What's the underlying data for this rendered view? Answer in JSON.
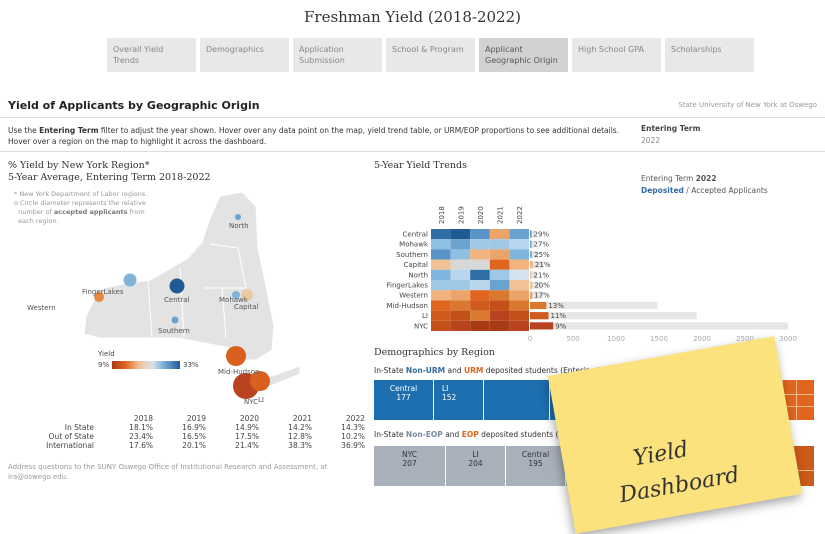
{
  "header": {
    "title": "Freshman Yield (2018-2022)"
  },
  "tabs": [
    {
      "label": "Overall Yield Trends"
    },
    {
      "label": "Demographics"
    },
    {
      "label": "Application Submission"
    },
    {
      "label": "School & Program"
    },
    {
      "label": "Applicant Geographic Origin"
    },
    {
      "label": "High School GPA"
    },
    {
      "label": "Scholarships"
    }
  ],
  "active_tab": "Applicant Geographic Origin",
  "section": {
    "title": "Yield of Applicants by Geographic Origin",
    "org": "State University of New York at Oswego",
    "intro_1": "Use the ",
    "intro_bold": "Entering Term",
    "intro_2": " filter to adjust the year shown. Hover over any data point on the map, yield trend table, or URM/EOP proportions to see additional details.",
    "intro_3": "Hover over a region on the map to highlight it across the dashboard."
  },
  "filter": {
    "label": "Entering Term",
    "value": "2022"
  },
  "map": {
    "title_1": "% Yield by New York Region*",
    "title_2": "5-Year Average, Entering Term 2018-2022",
    "note_1": "* New York Department of Labor regions.",
    "note_2": "o Circle diameter represents the relative",
    "note_3a": "number of ",
    "note_3b": "accepted applicants",
    "note_3c": " from",
    "note_4": "each region.",
    "labels": {
      "north": "North",
      "fingerlakes": "FingerLakes",
      "central": "Central",
      "mohawk": "Mohawk",
      "capital": "Capital",
      "western": "Western",
      "southern": "Southern",
      "midhudson": "Mid-Hudson",
      "nyc": "NYC",
      "li": "LI"
    },
    "legend": {
      "title": "Yield",
      "min": "9%",
      "max": "33%"
    },
    "colors": {
      "orange": "#e0661f",
      "blue": "#2f6ea6",
      "light_blue": "#7fb5dc",
      "beige": "#e8cba3",
      "dark_red": "#b8431e"
    }
  },
  "yield_table": {
    "years": [
      "2018",
      "2019",
      "2020",
      "2021",
      "2022"
    ],
    "rows": [
      {
        "label": "In State",
        "values": [
          "18.1%",
          "16.9%",
          "14.9%",
          "14.2%",
          "14.3%"
        ]
      },
      {
        "label": "Out of State",
        "values": [
          "23.4%",
          "16.5%",
          "17.5%",
          "12.8%",
          "10.2%"
        ]
      },
      {
        "label": "International",
        "values": [
          "17.6%",
          "20.1%",
          "21.4%",
          "38.3%",
          "36.9%"
        ]
      }
    ]
  },
  "footer": {
    "line1": "Address questions to the SUNY Oswego Office of Institutional Research and Assessment, at",
    "line2": "ira@oswego.edu."
  },
  "trends": {
    "title": "5-Year Yield Trends",
    "legend_line1_a": "Entering Term ",
    "legend_line1_b": "2022",
    "legend_line2_a": "Deposited",
    "legend_line2_b": " / Accepted Applicants"
  },
  "chart_data": {
    "type": "bar",
    "categories": [
      "Central",
      "Mohawk",
      "Southern",
      "Capital",
      "North",
      "FingerLakes",
      "Western",
      "Mid-Hudson",
      "LI",
      "NYC"
    ],
    "heatmap_years": [
      "2018",
      "2019",
      "2020",
      "2021",
      "2022"
    ],
    "heatmap_colors": [
      [
        "#2f6ea6",
        "#1f5a94",
        "#5a93c6",
        "#eba56a",
        "#6aa2d0"
      ],
      [
        "#8fbfe2",
        "#6aa2d0",
        "#9fc8e6",
        "#9fc8e6",
        "#b9d6ec"
      ],
      [
        "#5a93c6",
        "#8fbfe2",
        "#f2b37e",
        "#eba56a",
        "#7fb5dc"
      ],
      [
        "#f2c195",
        "#d8d8d8",
        "#d8d8d8",
        "#e0661f",
        "#f2b37e"
      ],
      [
        "#7fb5dc",
        "#b9d6ec",
        "#2f6ea6",
        "#9fc8e6",
        "#d5e3ee"
      ],
      [
        "#9fc8e6",
        "#9fc8e6",
        "#b9d6ec",
        "#6aa2d0",
        "#f2c195"
      ],
      [
        "#f2b37e",
        "#eba56a",
        "#e0661f",
        "#d9792f",
        "#eba56a"
      ],
      [
        "#e0661f",
        "#d9792f",
        "#cf5a1e",
        "#c45019",
        "#d9792f"
      ],
      [
        "#cf5a1e",
        "#c45019",
        "#d9792f",
        "#b8431e",
        "#c45019"
      ],
      [
        "#c45019",
        "#b8431e",
        "#a83a16",
        "#a83a16",
        "#b8431e"
      ]
    ],
    "percent_labels": [
      "29%",
      "27%",
      "25%",
      "21%",
      "21%",
      "20%",
      "17%",
      "13%",
      "11%",
      "9%"
    ],
    "accepted": [
      55,
      50,
      95,
      160,
      80,
      135,
      150,
      1480,
      1940,
      3000
    ],
    "deposited": [
      16,
      13,
      24,
      34,
      17,
      27,
      26,
      190,
      215,
      270
    ],
    "bar_colors": [
      "#5a93c6",
      "#6aa2d0",
      "#7fb5dc",
      "#f2b37e",
      "#f2c195",
      "#f2c195",
      "#eba56a",
      "#d9792f",
      "#cf5a1e",
      "#b8431e"
    ],
    "xticks": [
      "0",
      "500",
      "1000",
      "1500",
      "2000",
      "2500",
      "3000"
    ],
    "xlim": [
      0,
      3000
    ]
  },
  "demographics": {
    "title": "Demographics by Region",
    "urm_a": "In-State ",
    "urm_b": "Non-URM",
    "urm_c": " and ",
    "urm_d": "URM",
    "urm_e": " deposited students (Entering 2022 Term)",
    "urm_cells": [
      {
        "label": "Central",
        "value": "177"
      },
      {
        "label": "LI",
        "value": "152"
      }
    ],
    "eop_a": "In-State ",
    "eop_b": "Non-EOP",
    "eop_c": " and ",
    "eop_d": "EOP",
    "eop_e": " deposited students (Ente",
    "eop_cells": [
      {
        "label": "NYC",
        "value": "207"
      },
      {
        "label": "LI",
        "value": "204"
      },
      {
        "label": "Central",
        "value": "195"
      }
    ]
  },
  "sticky_note": {
    "line1": "Yield",
    "line2": "Dashboard"
  }
}
